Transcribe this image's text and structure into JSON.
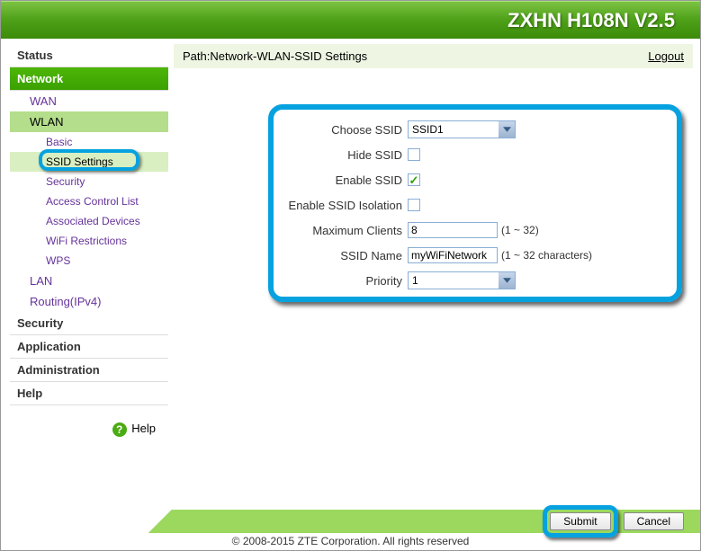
{
  "header": {
    "title": "ZXHN H108N V2.5"
  },
  "sidebar": {
    "items": [
      {
        "label": "Status"
      },
      {
        "label": "Network",
        "active": true
      },
      {
        "label": "Security"
      },
      {
        "label": "Application"
      },
      {
        "label": "Administration"
      },
      {
        "label": "Help"
      }
    ],
    "network_children": {
      "wan": "WAN",
      "wlan": "WLAN",
      "wlan_children": {
        "basic": "Basic",
        "ssid_settings": "SSID Settings",
        "security": "Security",
        "acl": "Access Control List",
        "assoc": "Associated Devices",
        "wifi_restrict": "WiFi Restrictions",
        "wps": "WPS"
      },
      "lan": "LAN",
      "routing": "Routing(IPv4)"
    },
    "help": "Help"
  },
  "path": {
    "text": "Path:Network-WLAN-SSID Settings",
    "logout": "Logout"
  },
  "form": {
    "choose_ssid_label": "Choose SSID",
    "choose_ssid_value": "SSID1",
    "hide_ssid_label": "Hide SSID",
    "hide_ssid_checked": false,
    "enable_ssid_label": "Enable SSID",
    "enable_ssid_checked": true,
    "isolation_label": "Enable SSID Isolation",
    "isolation_checked": false,
    "max_clients_label": "Maximum Clients",
    "max_clients_value": "8",
    "max_clients_hint": "(1 ~ 32)",
    "ssid_name_label": "SSID Name",
    "ssid_name_value": "myWiFiNetwork",
    "ssid_name_hint": "(1 ~ 32 characters)",
    "priority_label": "Priority",
    "priority_value": "1"
  },
  "footer": {
    "submit": "Submit",
    "cancel": "Cancel",
    "copyright": "© 2008-2015 ZTE Corporation. All rights reserved"
  }
}
